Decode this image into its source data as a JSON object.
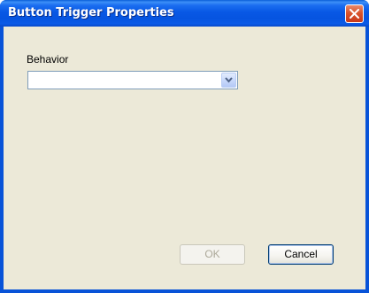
{
  "window": {
    "title": "Button Trigger Properties",
    "close_icon": "close-icon",
    "accent": "#0853d8",
    "close_color": "#d9542c"
  },
  "form": {
    "behavior_label": "Behavior",
    "behavior_value": "",
    "dropdown_icon": "chevron-down-icon"
  },
  "buttons": {
    "ok_label": "OK",
    "ok_enabled": false,
    "cancel_label": "Cancel"
  }
}
